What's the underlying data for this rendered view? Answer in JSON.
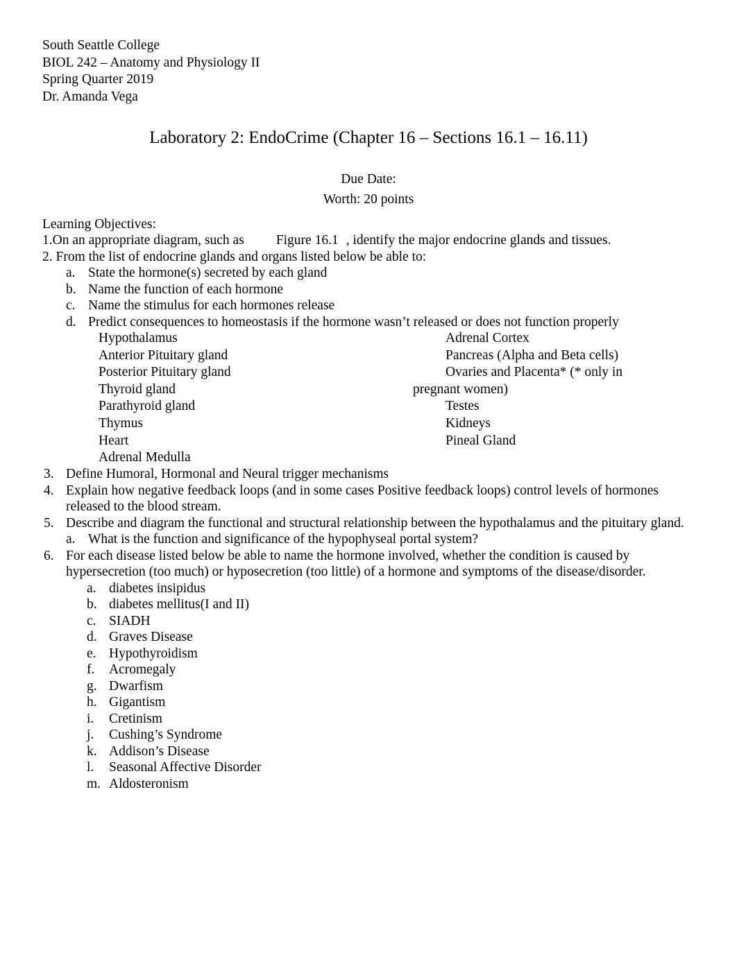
{
  "header": {
    "lines": [
      "South Seattle College",
      "BIOL 242 – Anatomy and Physiology II",
      "Spring Quarter 2019",
      "Dr. Amanda Vega"
    ]
  },
  "title": "Laboratory 2: EndoCrime (Chapter 16 – Sections 16.1 – 16.11)",
  "due": {
    "due_date_label": "Due Date:",
    "worth_label": "Worth: 20 points"
  },
  "objectives": {
    "heading": "Learning Objectives:",
    "item1": {
      "marker": "1.",
      "text_before": "On an appropriate diagram, such as",
      "figure_ref": "Figure 16.1",
      "text_after": ", identify the major endocrine glands and tissues."
    },
    "item2": {
      "marker": "2.",
      "text": " From the list of endocrine glands and organs listed below be able to:",
      "sub": [
        {
          "marker": "a.",
          "text": "State the hormone(s) secreted by each gland"
        },
        {
          "marker": "b.",
          "text": "Name the function of each hormone"
        },
        {
          "marker": "c.",
          "text": "Name the stimulus for each hormones release"
        },
        {
          "marker": "d.",
          "text": "Predict consequences to homeostasis if the hormone wasn’t released or does not function properly"
        }
      ]
    },
    "glands": {
      "left_column": [
        "Hypothalamus",
        "Anterior Pituitary gland",
        "Posterior Pituitary gland",
        "Thyroid gland",
        "Parathyroid gland",
        "Thymus",
        "Heart",
        "Adrenal Medulla"
      ],
      "right_column": [
        "Adrenal Cortex",
        "Pancreas (Alpha and Beta cells)",
        "Ovaries and Placenta* (* only in",
        "pregnant women)",
        "Testes",
        "Kidneys",
        "Pineal Gland"
      ]
    },
    "item3": {
      "marker": "3.",
      "text": "Define Humoral, Hormonal and Neural trigger mechanisms"
    },
    "item4": {
      "marker": "4.",
      "text": "Explain how negative feedback loops (and in some cases Positive feedback loops) control levels of hormones released to the blood stream."
    },
    "item5": {
      "marker": "5.",
      "text": "Describe and diagram the functional and structural relationship between the hypothalamus and the pituitary gland.",
      "sub": [
        {
          "marker": "a.",
          "text": "What is the function and significance of the hypophyseal portal system?"
        }
      ]
    },
    "item6": {
      "marker": "6.",
      "text": " For each disease listed below be able to name the hormone involved, whether the condition is caused by hypersecretion (too much) or hyposecretion (too little) of a hormone and symptoms of the disease/disorder.",
      "diseases": [
        {
          "marker": "a.",
          "text": "diabetes insipidus"
        },
        {
          "marker": "b.",
          "text": "diabetes mellitus(I and II)"
        },
        {
          "marker": "c.",
          "text": "SIADH"
        },
        {
          "marker": "d.",
          "text": "Graves Disease"
        },
        {
          "marker": "e.",
          "text": "Hypothyroidism"
        },
        {
          "marker": "f.",
          "text": "Acromegaly"
        },
        {
          "marker": "g.",
          "text": "Dwarfism"
        },
        {
          "marker": "h.",
          "text": "Gigantism"
        },
        {
          "marker": "i.",
          "text": "Cretinism"
        },
        {
          "marker": "j.",
          "text": "Cushing’s Syndrome"
        },
        {
          "marker": "k.",
          "text": "Addison’s Disease"
        },
        {
          "marker": "l.",
          "text": "Seasonal Affective Disorder"
        },
        {
          "marker": "m.",
          "text": "Aldosteronism"
        }
      ]
    }
  }
}
